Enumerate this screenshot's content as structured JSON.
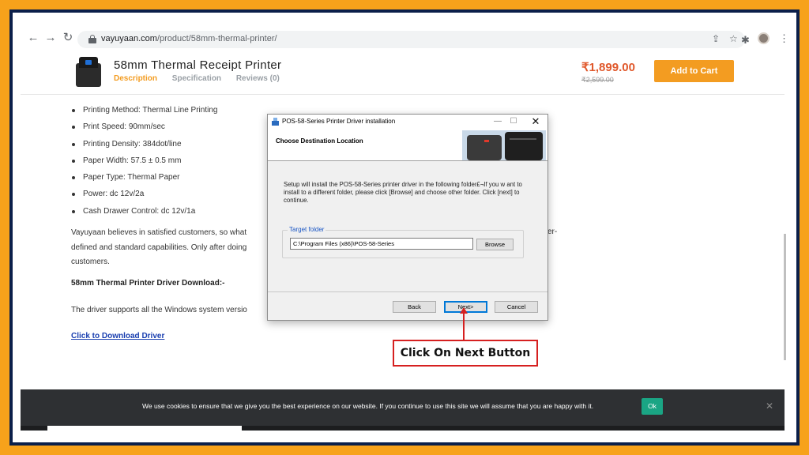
{
  "browser": {
    "url_domain": "vayuyaan.com",
    "url_path": "/product/58mm-thermal-printer/",
    "back_icon": "arrow-left-icon",
    "forward_icon": "arrow-right-icon",
    "reload_icon": "reload-icon"
  },
  "product": {
    "title": "58mm Thermal Receipt Printer",
    "tabs": [
      {
        "label": "Description"
      },
      {
        "label": "Specification"
      },
      {
        "label": "Reviews (0)"
      }
    ],
    "active_tab": "Description",
    "price": "₹1,899.00",
    "old_price": "₹2,599.00",
    "add_to_cart": "Add to Cart",
    "accent_color": "#f39c21",
    "price_color": "#e0582b"
  },
  "specs": [
    "Printing Method: Thermal Line Printing",
    "Print Speed: 90mm/sec",
    "Printing Density: 384dot/line",
    "Paper Width: 57.5 ± 0.5 mm",
    "Paper Type: Thermal Paper",
    "Power: dc 12v/2a",
    "Cash Drawer Control: dc 12v/1a"
  ],
  "content": {
    "paragraph_line1": "Vayuyaan believes in satisfied customers, so what",
    "paragraph_line1_end": "er-",
    "paragraph_line2": "defined and standard capabilities. Only after doing",
    "paragraph_line3": "customers.",
    "download_heading": "58mm Thermal Printer Driver Download:-",
    "support_text": "The driver supports all the Windows system versio",
    "download_link": "Click to Download Driver"
  },
  "dialog": {
    "title": "POS-58-Series Printer Driver installation",
    "subtitle": "Choose Destination Location",
    "description": "Setup will install the POS-58-Series printer driver in the following folder£¬If you w ant to install to a different folder, please click [Browse] and choose other folder. Click [next] to continue.",
    "group_label": "Target folder",
    "folder_path": "C:\\Program Files (x86)\\POS-58-Series",
    "browse": "Browse",
    "back": "Back",
    "next": "Next>",
    "cancel": "Cancel",
    "minimize_glyph": "—",
    "maximize_glyph": "☐",
    "close_glyph": "✕"
  },
  "annotation": {
    "callout": "Click On Next Button",
    "color": "#d62020"
  },
  "cookie": {
    "text": "We use cookies to ensure that we give you the best experience on our website. If you continue to use this site we will assume that you are happy with it.",
    "ok": "Ok",
    "close_glyph": "✕"
  }
}
